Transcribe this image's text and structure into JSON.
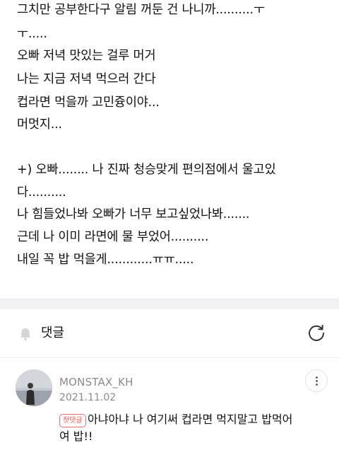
{
  "post": {
    "lines": [
      "그치만 공부한다구 알림 꺼둔 건 나니까..........ㅜ",
      "ㅜ.....",
      "오빠 저녁 맛있는 걸루 머거",
      "나는 지금 저녁 먹으러 간다",
      "컵라면 먹을까 고민즁이야...",
      "머멋지...",
      "+) 오빠........ 나 진짜 청승맞게 편의점에서 울고있",
      "다..........",
      "나 힘들었나봐 오빠가 너무 보고싶었나봐.......",
      "근데 나 이미 라면에 물 부었어..........",
      "내일 꼭 밥 먹을게............ㅠㅠ....."
    ]
  },
  "comments_section": {
    "title": "댓글",
    "icons": {
      "notify": "bell-icon",
      "refresh": "refresh-icon",
      "more": "more-vertical-icon"
    }
  },
  "comment": {
    "author": "MONSTAX_KH",
    "date": "2021.11.02",
    "badge": "첫댓글",
    "lines": [
      "아냐아냐 나 여기써 컵라면 먹지말고 밥먹어",
      "여 밥!!"
    ]
  },
  "colors": {
    "text": "#111111",
    "muted": "#8a8a8e",
    "badge": "#f05454",
    "separator": "#f2f2f4"
  }
}
